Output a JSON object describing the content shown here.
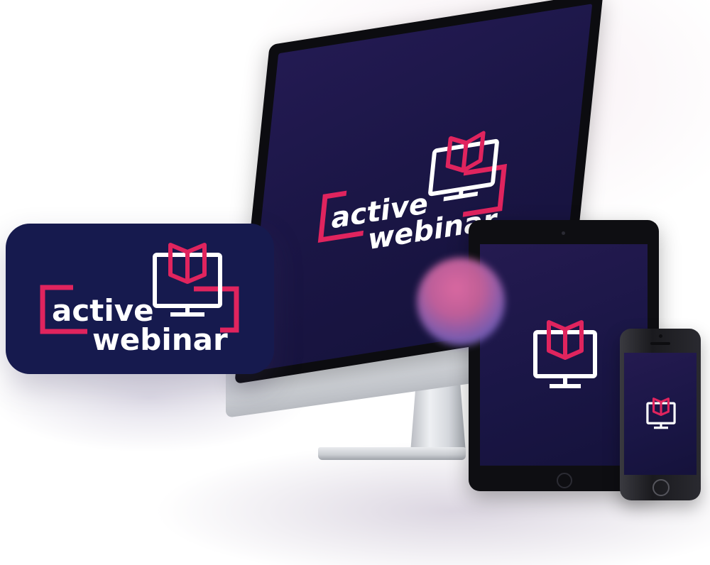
{
  "brand": {
    "word1": "active",
    "word2": "webinar"
  },
  "icons": {
    "book": "book-icon",
    "monitor": "monitor-icon"
  },
  "colors": {
    "accent": "#e0245e",
    "navy": "#161a4e",
    "text": "#ffffff"
  }
}
